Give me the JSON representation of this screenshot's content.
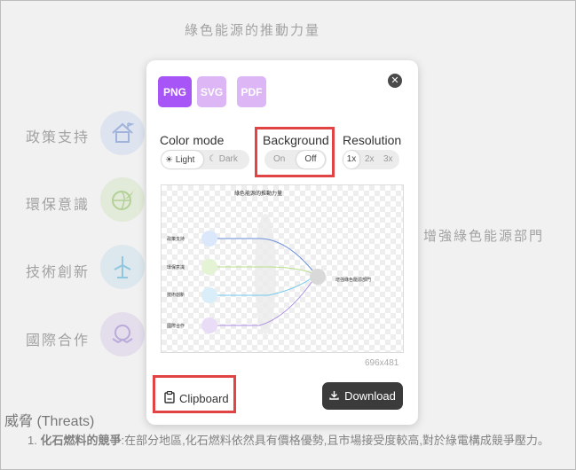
{
  "background": {
    "title": "綠色能源的推動力量",
    "categories": [
      "政策支持",
      "環保意識",
      "技術創新",
      "國際合作"
    ],
    "target": "增強綠色能源部門",
    "threats_heading": "威脅 (Threats)",
    "threat_item_number": "1.",
    "threat_item_bold": "化石燃料的競爭",
    "threat_item_text": ":在部分地區,化石燃料依然具有價格優勢,且市場接受度較高,對於綠電構成競爭壓力。"
  },
  "modal": {
    "formats": [
      "PNG",
      "SVG",
      "PDF"
    ],
    "selected_format": "PNG",
    "close_icon": "close-icon",
    "color_mode": {
      "label": "Color mode",
      "options": [
        "Light",
        "Dark"
      ],
      "selected": "Light"
    },
    "background": {
      "label": "Background",
      "options": [
        "On",
        "Off"
      ],
      "selected": "Off"
    },
    "resolution": {
      "label": "Resolution",
      "options": [
        "1x",
        "2x",
        "3x"
      ],
      "selected": "1x"
    },
    "preview": {
      "title": "綠色能源的推動力量",
      "categories": [
        "政策支持",
        "環保意識",
        "技術創新",
        "國際合作"
      ],
      "target": "增強綠色能源部門"
    },
    "dimensions": "696x481",
    "clipboard_label": "Clipboard",
    "download_label": "Download"
  },
  "colors": {
    "accent_purple": "#a855f7",
    "accent_purple_light": "#dcb6f5",
    "highlight_red": "#e04444",
    "download_dark": "#3b3b3b",
    "circle_blue": "#dbe7fb",
    "circle_green": "#e3f3d3",
    "circle_cyan": "#d9eef8",
    "circle_lavender": "#e8dcf6"
  }
}
